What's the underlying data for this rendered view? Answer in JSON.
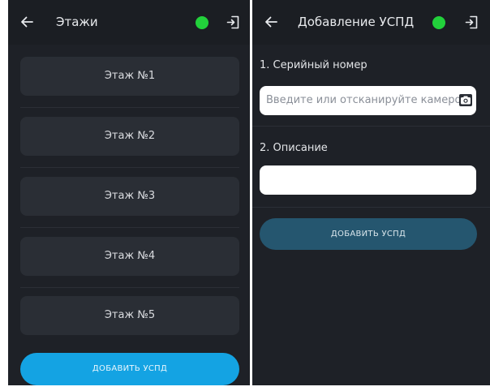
{
  "colors": {
    "status_online": "#22d13b",
    "primary_button": "#14a3e3",
    "primary_button_pressed": "#25566f",
    "background": "#1e2127",
    "card": "#2a2e35"
  },
  "floors_screen": {
    "back_icon": "arrow-left-icon",
    "title": "Этажи",
    "status_icon": "green-dot-icon",
    "exit_icon": "logout-icon",
    "floors": [
      {
        "label": "Этаж №1"
      },
      {
        "label": "Этаж №2"
      },
      {
        "label": "Этаж №3"
      },
      {
        "label": "Этаж №4"
      },
      {
        "label": "Этаж №5"
      }
    ],
    "add_button_label": "ДОБАВИТЬ УСПД"
  },
  "add_uspd_screen": {
    "back_icon": "arrow-left-icon",
    "title": "Добавление УСПД",
    "status_icon": "green-dot-icon",
    "exit_icon": "logout-icon",
    "serial_label": "1. Серийный номер",
    "serial_placeholder": "Введите или отсканируйте камерой",
    "serial_value": "",
    "camera_icon": "camera-icon",
    "description_label": "2. Описание",
    "description_value": "",
    "add_button_label": "ДОБАВИТЬ УСПД"
  }
}
